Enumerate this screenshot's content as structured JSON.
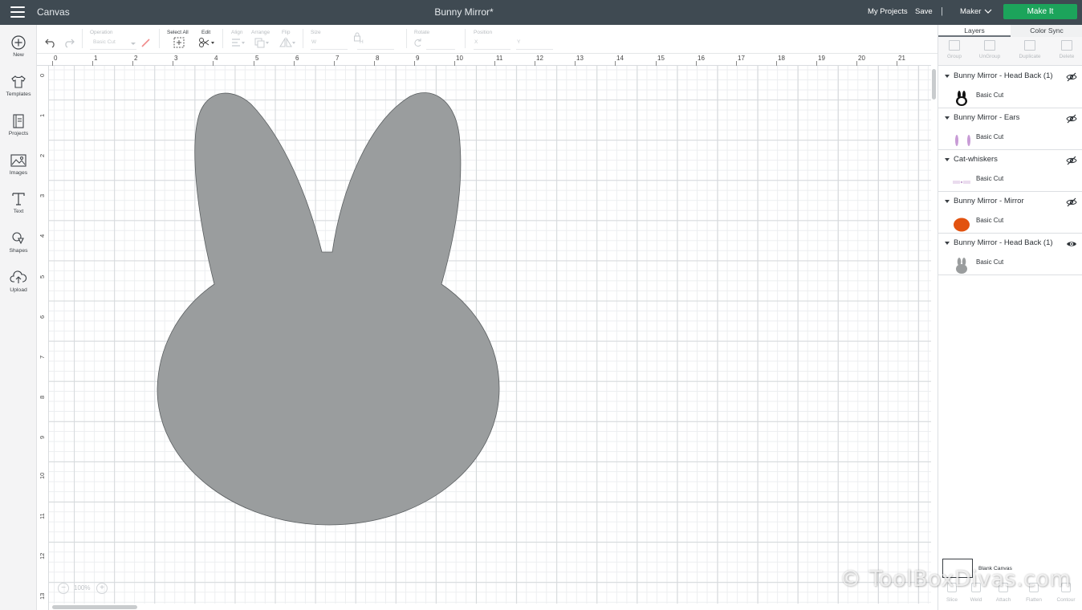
{
  "header": {
    "app_title": "Canvas",
    "document_title": "Bunny Mirror*",
    "my_projects": "My Projects",
    "save": "Save",
    "separator": "|",
    "machine": "Maker",
    "make_it": "Make It",
    "bg_color": "#3f4a52",
    "make_it_color": "#1ca45b"
  },
  "toolbar": {
    "operation_label": "Operation",
    "operation_value": "Basic Cut",
    "select_all": "Select All",
    "edit": "Edit",
    "align": "Align",
    "arrange": "Arrange",
    "flip": "Flip",
    "size": "Size",
    "size_w": "W",
    "size_h": "H",
    "rotate": "Rotate",
    "position": "Position",
    "position_x": "X",
    "position_y": "Y"
  },
  "sidebar": {
    "items": [
      {
        "label": "New",
        "icon": "plus-circle-icon"
      },
      {
        "label": "Templates",
        "icon": "tshirt-icon"
      },
      {
        "label": "Projects",
        "icon": "projects-icon"
      },
      {
        "label": "Images",
        "icon": "image-icon"
      },
      {
        "label": "Text",
        "icon": "text-icon"
      },
      {
        "label": "Shapes",
        "icon": "shapes-icon"
      },
      {
        "label": "Upload",
        "icon": "cloud-upload-icon"
      }
    ]
  },
  "rulers": {
    "top": [
      "0",
      "1",
      "2",
      "3",
      "4",
      "5",
      "6",
      "7",
      "8",
      "9",
      "10",
      "11",
      "12",
      "13",
      "14",
      "15",
      "16",
      "17",
      "18",
      "19",
      "20",
      "21"
    ],
    "left": [
      "0",
      "1",
      "2",
      "3",
      "4",
      "5",
      "6",
      "7",
      "8",
      "9",
      "10",
      "11",
      "12",
      "13"
    ]
  },
  "canvas": {
    "shape_color": "#9a9d9e",
    "zoom": "100%",
    "zoom_minus": "−",
    "zoom_plus": "+"
  },
  "panel": {
    "tabs": [
      "Layers",
      "Color Sync"
    ],
    "actions": [
      "Group",
      "UnGroup",
      "Duplicate",
      "Delete"
    ],
    "layers": [
      {
        "name": "Bunny Mirror - Head Back (1)",
        "operation": "Basic Cut",
        "visible": false,
        "thumb_color": "#111111"
      },
      {
        "name": "Bunny Mirror - Ears",
        "operation": "Basic Cut",
        "visible": false,
        "thumb_color": "#c89bd6"
      },
      {
        "name": "Cat-whiskers",
        "operation": "Basic Cut",
        "visible": false,
        "thumb_color": "#c7a3d3"
      },
      {
        "name": "Bunny Mirror - Mirror",
        "operation": "Basic Cut",
        "visible": false,
        "thumb_color": "#e2520f"
      },
      {
        "name": "Bunny Mirror - Head Back (1)",
        "operation": "Basic Cut",
        "visible": true,
        "thumb_color": "#9a9d9e"
      }
    ],
    "blank_canvas": "Blank Canvas",
    "bottom_actions": [
      "Slice",
      "Weld",
      "Attach",
      "Flatten",
      "Contour"
    ]
  },
  "watermark": "© ToolBoxDivas.com"
}
